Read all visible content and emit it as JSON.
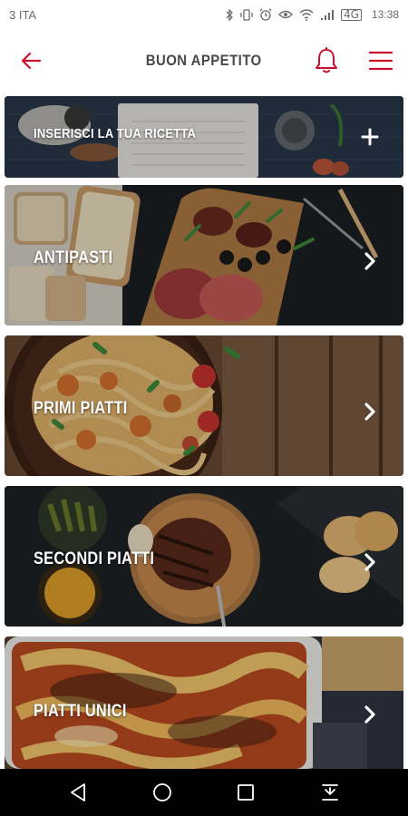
{
  "status_bar": {
    "carrier": "3 ITA",
    "network": "4G",
    "time": "13:38"
  },
  "app_bar": {
    "title": "BUON APPETITO"
  },
  "cards": [
    {
      "label": "INSERISCI LA TUA RICETTA",
      "action_icon": "plus-icon"
    },
    {
      "label": "ANTIPASTI",
      "action_icon": "chevron-right-icon"
    },
    {
      "label": "PRIMI PIATTI",
      "action_icon": "chevron-right-icon"
    },
    {
      "label": "SECONDI PIATTI",
      "action_icon": "chevron-right-icon"
    },
    {
      "label": "PIATTI UNICI",
      "action_icon": "chevron-right-icon"
    }
  ],
  "colors": {
    "accent": "#c8102e",
    "title": "#4a4a4a"
  }
}
